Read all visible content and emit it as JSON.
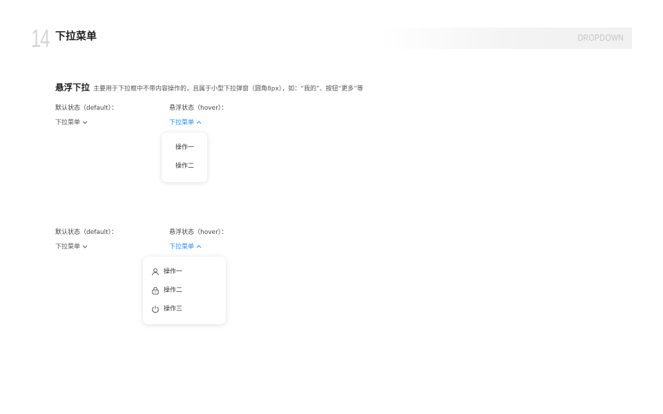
{
  "header": {
    "section_number": "14",
    "title": "下拉菜单",
    "english_title": "DROPDOWN"
  },
  "subsection": {
    "title": "悬浮下拉",
    "description": "主要用于下拉框中不带内容操作的，且属于小型下拉弹窗（圆角8px），如：“我的”、按钮“更多”等"
  },
  "example_one": {
    "default_label": "默认状态（default）：",
    "hover_label": "悬浮状态（hover）：",
    "default_trigger": "下拉菜单",
    "hover_trigger": "下拉菜单",
    "menu_items": [
      {
        "label": "操作一"
      },
      {
        "label": "操作二"
      }
    ]
  },
  "example_two": {
    "default_label": "默认状态（default）：",
    "hover_label": "悬浮状态（hover）：",
    "default_trigger": "下拉菜单",
    "hover_trigger": "下拉菜单",
    "menu_items": [
      {
        "label": "操作一",
        "icon": "user-icon"
      },
      {
        "label": "操作二",
        "icon": "lock-icon"
      },
      {
        "label": "操作三",
        "icon": "power-icon"
      }
    ]
  },
  "colors": {
    "accent": "#2a8cf0",
    "text": "#333333",
    "section_number": "#d6d6d6",
    "english_title": "#c4c4c4"
  }
}
